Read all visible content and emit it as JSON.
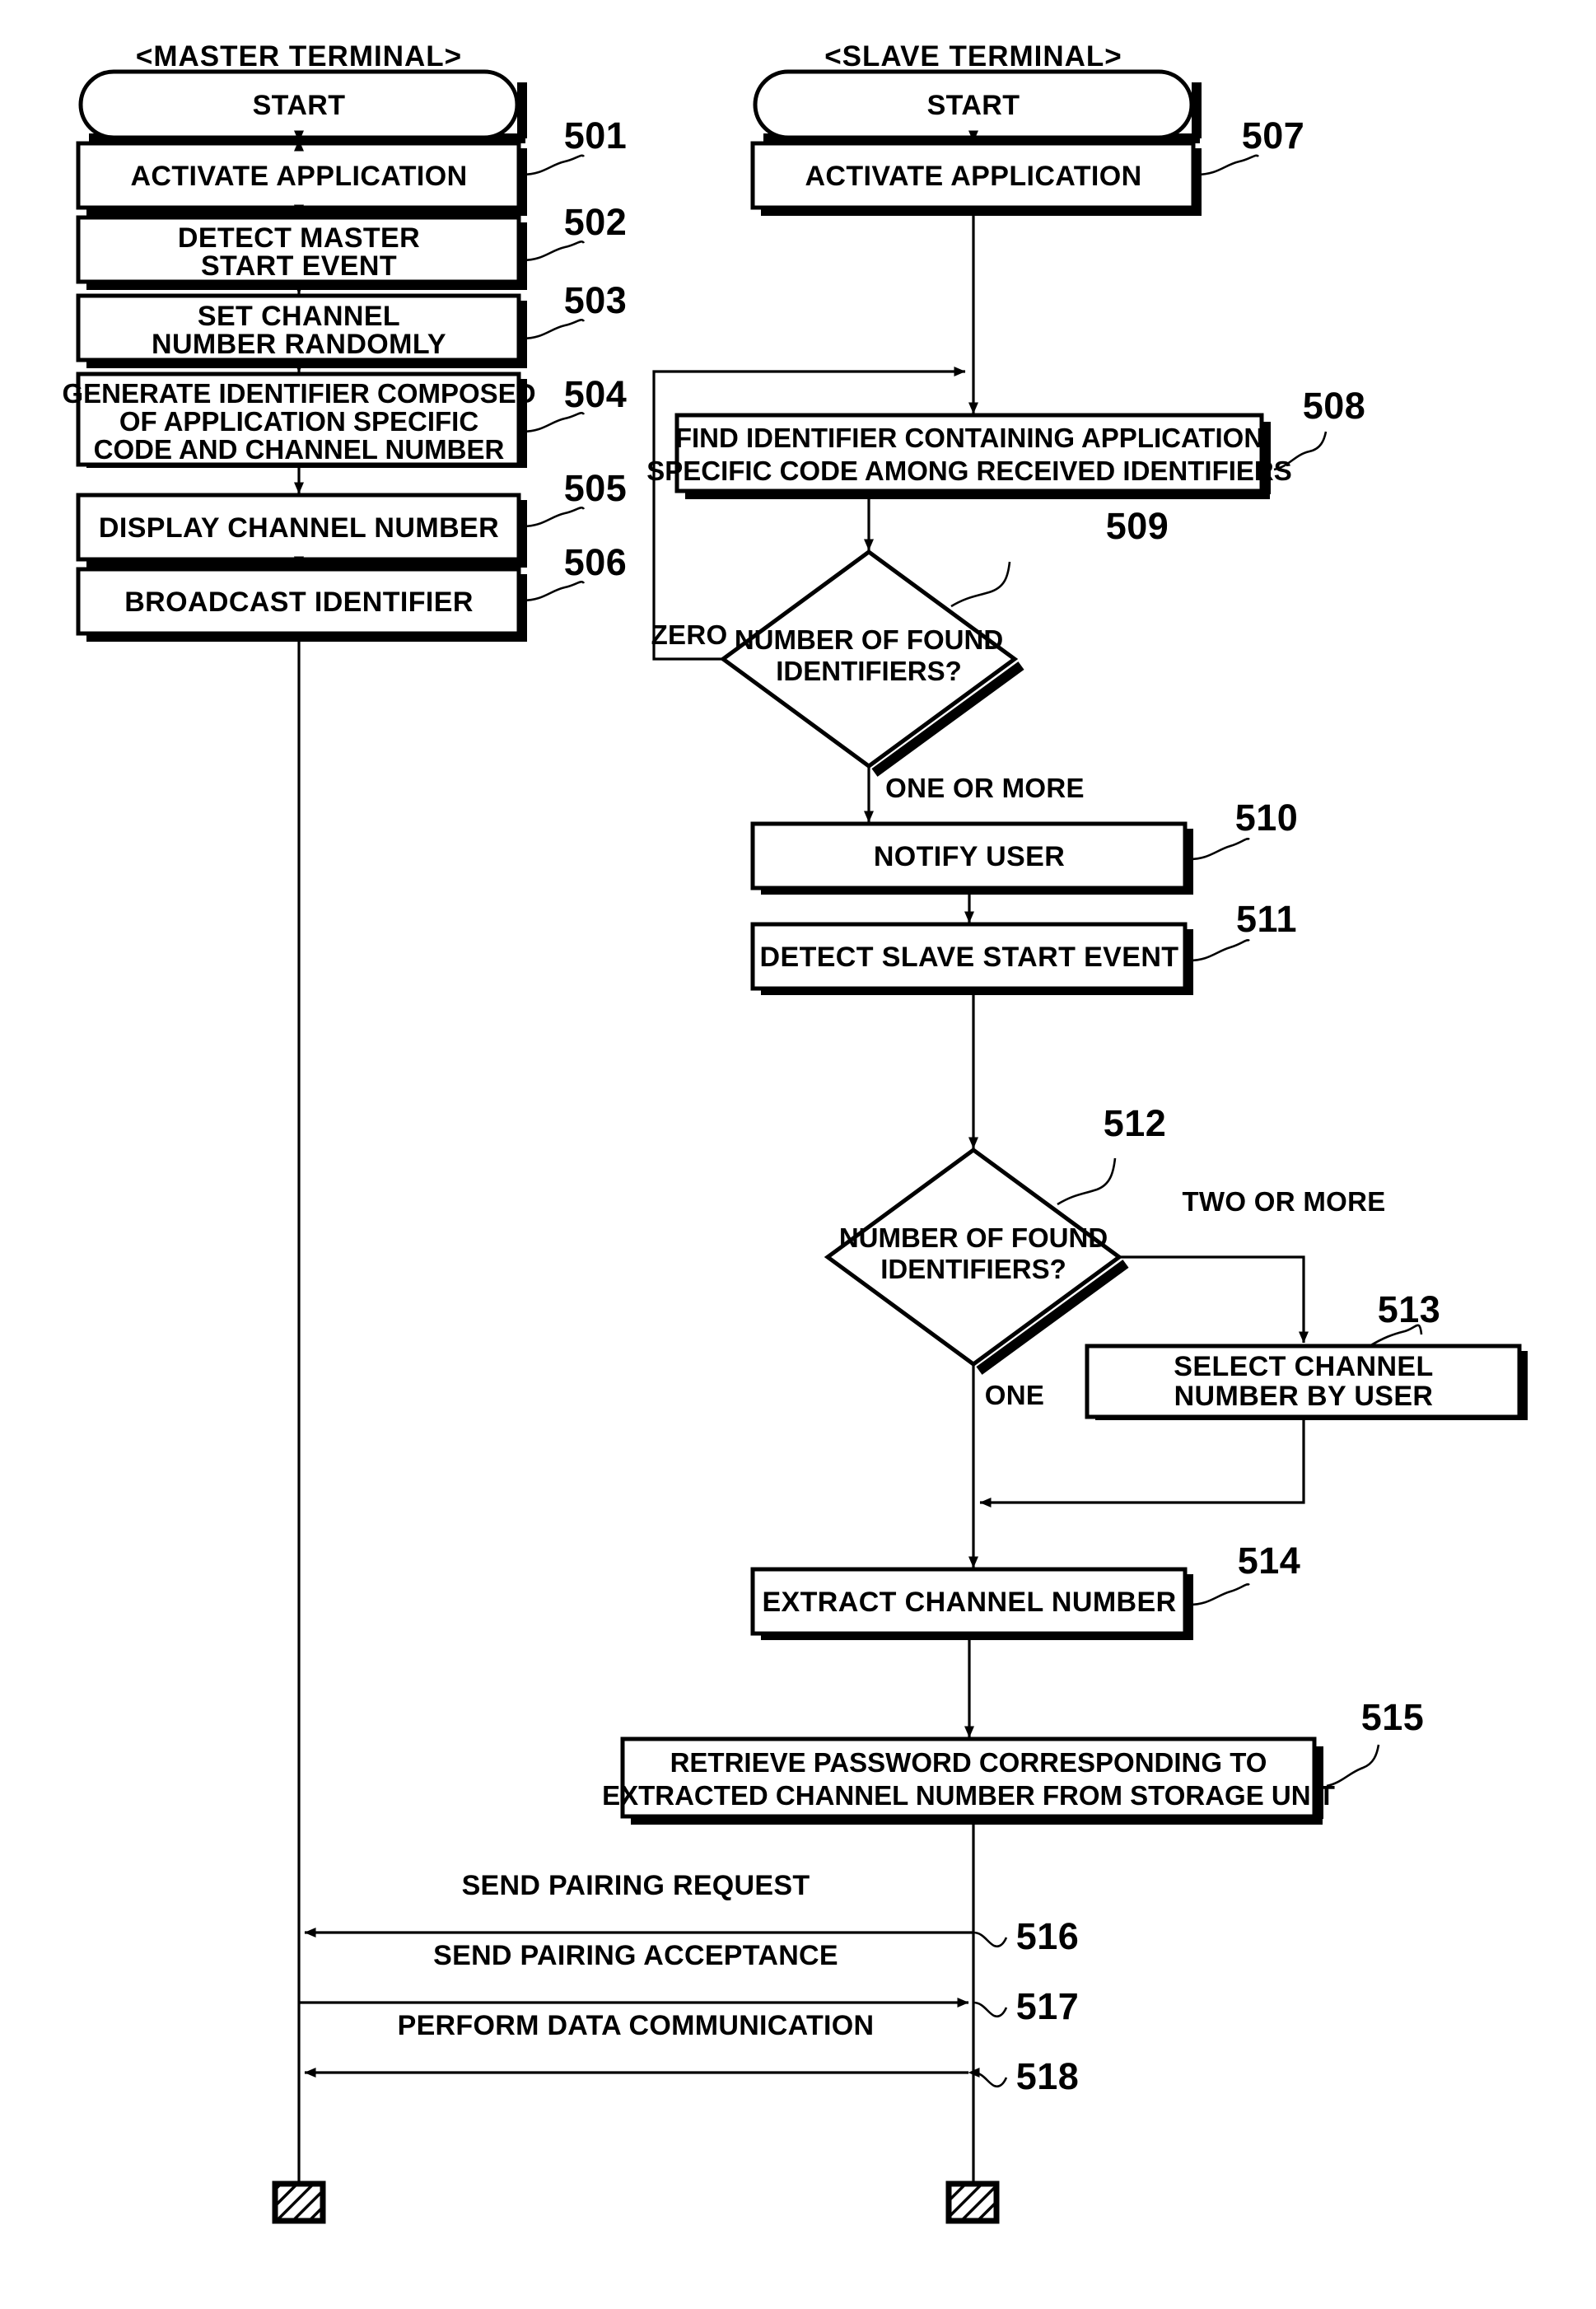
{
  "figure": {
    "columns": [
      {
        "id": "master",
        "header": "<MASTER TERMINAL>"
      },
      {
        "id": "slave",
        "header": "<SLAVE TERMINAL>"
      }
    ],
    "terminators": [
      {
        "id": "master-start",
        "label": "START"
      },
      {
        "id": "slave-start",
        "label": "START"
      }
    ],
    "master_steps": [
      {
        "ref": "501",
        "lines": [
          "ACTIVATE APPLICATION"
        ]
      },
      {
        "ref": "502",
        "lines": [
          "DETECT MASTER",
          "START EVENT"
        ]
      },
      {
        "ref": "503",
        "lines": [
          "SET CHANNEL",
          "NUMBER RANDOMLY"
        ]
      },
      {
        "ref": "504",
        "lines": [
          "GENERATE IDENTIFIER COMPOSED",
          "OF APPLICATION SPECIFIC",
          "CODE AND CHANNEL NUMBER"
        ]
      },
      {
        "ref": "505",
        "lines": [
          "DISPLAY CHANNEL NUMBER"
        ]
      },
      {
        "ref": "506",
        "lines": [
          "BROADCAST IDENTIFIER"
        ]
      }
    ],
    "slave_steps": [
      {
        "ref": "507",
        "lines": [
          "ACTIVATE APPLICATION"
        ]
      },
      {
        "ref": "508",
        "lines": [
          "FIND IDENTIFIER CONTAINING APPLICATION",
          "SPECIFIC CODE AMONG RECEIVED IDENTIFIERS"
        ]
      },
      {
        "ref": "509",
        "shape": "decision",
        "lines": [
          "NUMBER OF FOUND",
          "IDENTIFIERS?"
        ]
      },
      {
        "ref": "510",
        "lines": [
          "NOTIFY USER"
        ]
      },
      {
        "ref": "511",
        "lines": [
          "DETECT SLAVE START EVENT"
        ]
      },
      {
        "ref": "512",
        "shape": "decision",
        "lines": [
          "NUMBER OF FOUND",
          "IDENTIFIERS?"
        ]
      },
      {
        "ref": "513",
        "lines": [
          "SELECT CHANNEL",
          "NUMBER BY USER"
        ]
      },
      {
        "ref": "514",
        "lines": [
          "EXTRACT CHANNEL NUMBER"
        ]
      },
      {
        "ref": "515",
        "lines": [
          "RETRIEVE PASSWORD CORRESPONDING TO",
          "EXTRACTED CHANNEL NUMBER FROM STORAGE UNIT"
        ]
      }
    ],
    "branch_labels": {
      "d509_zero": "ZERO",
      "d509_one_or_more": "ONE OR MORE",
      "d512_two_or_more": "TWO OR MORE",
      "d512_one": "ONE"
    },
    "messages": [
      {
        "ref": "516",
        "label": "SEND PAIRING REQUEST",
        "direction": "slave-to-master"
      },
      {
        "ref": "517",
        "label": "SEND PAIRING ACCEPTANCE",
        "direction": "master-to-slave"
      },
      {
        "ref": "518",
        "label": "PERFORM DATA COMMUNICATION",
        "direction": "bidirectional"
      }
    ],
    "colors": {
      "ink": "#000000",
      "paper": "#ffffff"
    }
  }
}
